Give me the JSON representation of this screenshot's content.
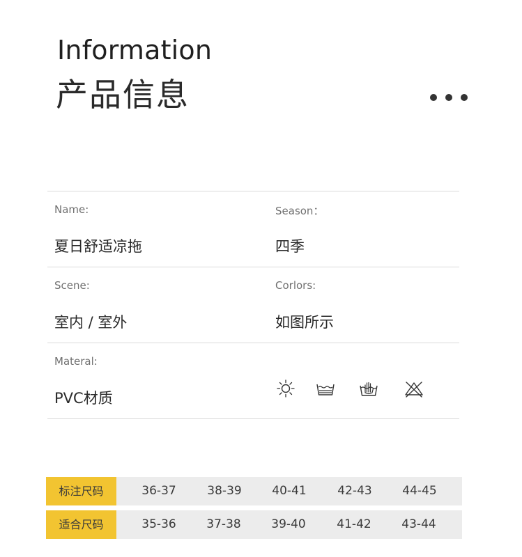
{
  "header": {
    "title_en": "Information",
    "title_cn": "产品信息",
    "more_icon": "ellipsis-icon"
  },
  "info": {
    "name_label": "Name:",
    "name_value": "夏日舒适凉拖",
    "season_label": "Season：",
    "season_value": "四季",
    "scene_label": "Scene:",
    "scene_value": "室内 / 室外",
    "colors_label": "Corlors:",
    "colors_value": "如图所示",
    "material_label": "Materal:",
    "material_value": "PVC材质",
    "care_icons": [
      "sun-dry-icon",
      "water-wash-icon",
      "hand-wash-icon",
      "no-bleach-icon"
    ]
  },
  "sizes": {
    "row1": {
      "label": "标注尺码",
      "values": [
        "36-37",
        "38-39",
        "40-41",
        "42-43",
        "44-45"
      ]
    },
    "row2": {
      "label": "适合尺码",
      "values": [
        "35-36",
        "37-38",
        "39-40",
        "41-42",
        "43-44"
      ]
    }
  },
  "colors": {
    "accent": "#f2c431",
    "row_bg": "#ececec",
    "divider": "#d9d9d9"
  }
}
